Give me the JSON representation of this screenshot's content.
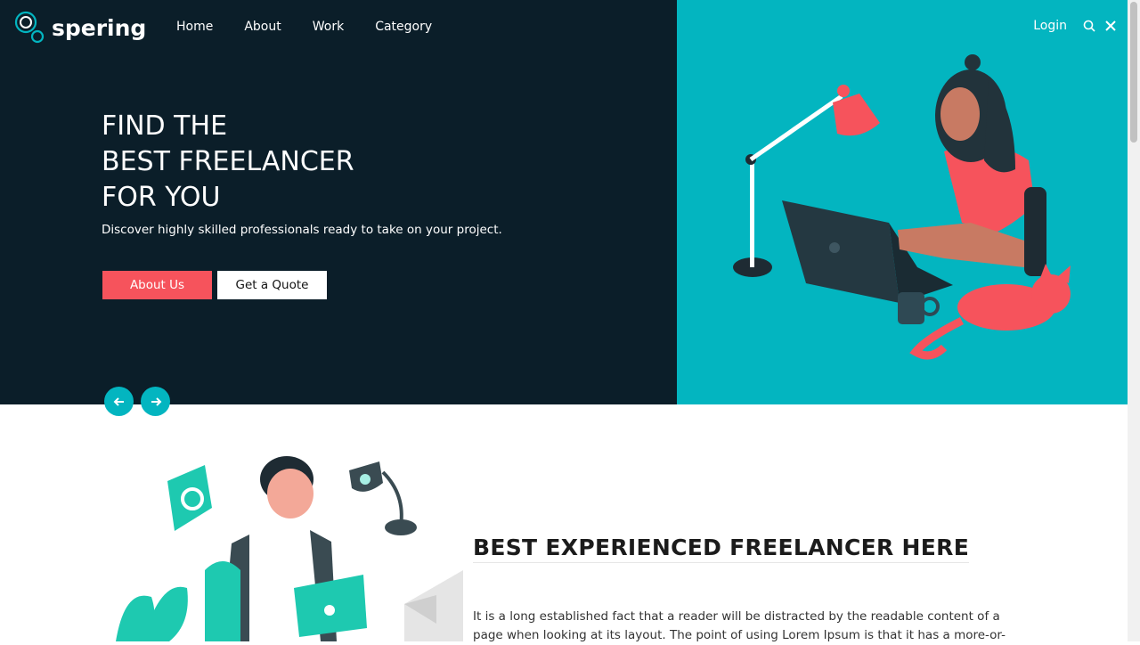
{
  "brand": {
    "name": "spering"
  },
  "nav": [
    {
      "label": "Home"
    },
    {
      "label": "About"
    },
    {
      "label": "Work"
    },
    {
      "label": "Category"
    }
  ],
  "header_actions": {
    "login": "Login",
    "search_icon": "search-icon",
    "close_icon": "close-icon"
  },
  "hero": {
    "title_lines": [
      "FIND THE",
      "BEST FREELANCER",
      "FOR YOU"
    ],
    "subtitle": "Discover highly skilled professionals ready to take on your project.",
    "primary_button": "About Us",
    "secondary_button": "Get a Quote",
    "prev_icon": "arrow-left-icon",
    "next_icon": "arrow-right-icon"
  },
  "section": {
    "title": "BEST EXPERIENCED FREELANCER HERE",
    "body": "It is a long established fact that a reader will be distracted by the readable content of a page when looking at its layout. The point of using Lorem Ipsum is that it has a more-or-"
  },
  "colors": {
    "dark": "#0b1e29",
    "teal": "#03b5c0",
    "coral": "#f6535c"
  }
}
